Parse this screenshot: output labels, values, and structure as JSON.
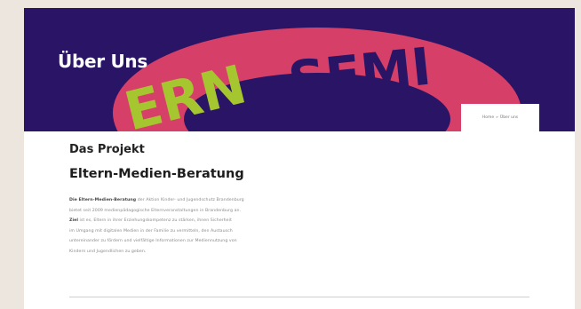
{
  "hero": {
    "title": "Über Uns",
    "art_words": [
      "ERN",
      "SEMI"
    ]
  },
  "breadcrumb": {
    "home": "Home",
    "separator": "»",
    "current": "Über uns"
  },
  "content": {
    "section_title": "Das Projekt",
    "subtitle": "Eltern-Medien-Beratung",
    "intro_strong": "Die Eltern-Medien-Beratung",
    "intro_line1_rest": " der Aktion Kinder- und Jugendschutz Brandenburg",
    "line2": "bietet seit 2009 medienpädagogische Elternveranstaltungen in Brandenburg an.",
    "line3_strong": "Ziel",
    "line3_rest": " ist es, Eltern in ihrer Erziehungskompetenz zu stärken, ihnen Sicherheit",
    "line4": "im Umgang mit digitalen Medien in der Familie zu vermitteln, den Austausch",
    "line5": "untereinander zu fördern und vielfältige Informationen zur Mediennutzung von",
    "line6": "Kindern und Jugendlichen zu geben."
  },
  "colors": {
    "hero_bg": "#2a1466",
    "ring_red": "#d64068",
    "ring_green": "#a6c630",
    "letter_dark": "#2a1466"
  }
}
